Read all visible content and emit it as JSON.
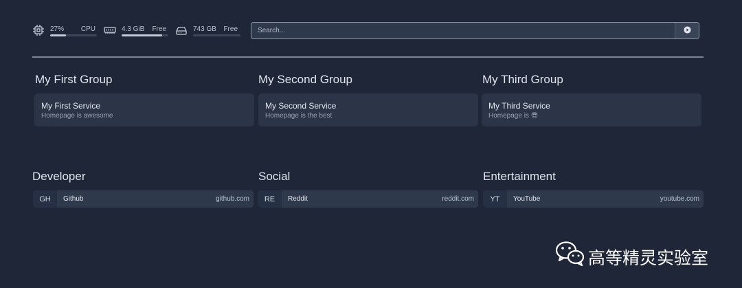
{
  "status": {
    "cpu": {
      "value": "27%",
      "label": "CPU",
      "fill": 0.34,
      "icon": "cpu-icon"
    },
    "memory": {
      "value": "4.3 GiB",
      "label": "Free",
      "fill": 0.87,
      "icon": "memory-icon"
    },
    "disk": {
      "value": "743 GB",
      "label": "Free",
      "fill": 0.0,
      "icon": "disk-icon"
    }
  },
  "search": {
    "placeholder": "Search...",
    "submit_icon": "play-circle-icon"
  },
  "groups": [
    {
      "title": "My First Group",
      "service": {
        "name": "My First Service",
        "description": "Homepage is awesome"
      }
    },
    {
      "title": "My Second Group",
      "service": {
        "name": "My Second Service",
        "description": "Homepage is the best"
      }
    },
    {
      "title": "My Third Group",
      "service": {
        "name": "My Third Service",
        "description": "Homepage is 😎"
      }
    }
  ],
  "bookmark_groups": [
    {
      "title": "Developer",
      "item": {
        "abbr": "GH",
        "name": "Github",
        "url": "github.com"
      }
    },
    {
      "title": "Social",
      "item": {
        "abbr": "RE",
        "name": "Reddit",
        "url": "reddit.com"
      }
    },
    {
      "title": "Entertainment",
      "item": {
        "abbr": "YT",
        "name": "YouTube",
        "url": "youtube.com"
      }
    }
  ],
  "watermark": {
    "text": "高等精灵实验室",
    "icon": "wechat-icon"
  },
  "colors": {
    "background": "#1e2638",
    "card": "#2c3547",
    "text": "#dfe4ea",
    "divider": "#7b8596"
  }
}
